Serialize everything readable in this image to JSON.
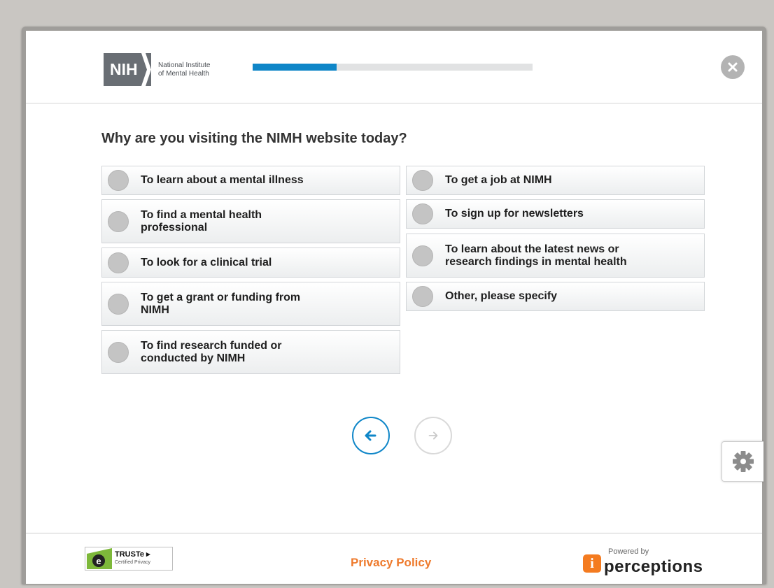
{
  "header": {
    "logo_abbr": "NIH",
    "logo_line1": "National Institute",
    "logo_line2": "of Mental Health",
    "progress_fraction": 0.3
  },
  "question": "Why are you visiting the NIMH website today?",
  "options_left": [
    "To learn about a mental illness",
    "To find a mental health professional",
    "To look for a clinical trial",
    "To get a grant or funding from NIMH",
    "To find research funded or conducted by NIMH"
  ],
  "options_right": [
    "To get a job at NIMH",
    "To sign up for newsletters",
    "To learn about the latest news or research findings in mental health",
    "Other, please specify"
  ],
  "footer": {
    "truste_brand": "TRUSTe",
    "truste_sub": "Certified Privacy",
    "privacy_link": "Privacy Policy",
    "powered_by": "Powered by",
    "brand": "perceptions"
  },
  "colors": {
    "accent": "#0f86c8",
    "link": "#ee7a2c"
  },
  "icons": {
    "close": "close-icon",
    "back": "arrow-left-icon",
    "next": "arrow-right-icon",
    "settings": "gear-icon"
  }
}
